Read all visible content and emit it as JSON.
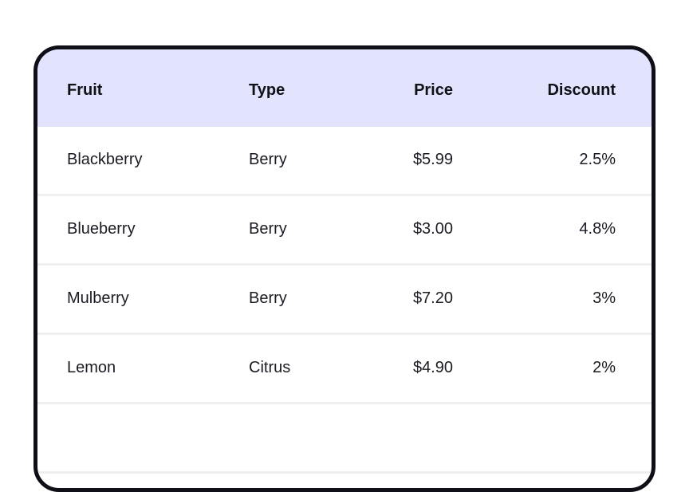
{
  "table": {
    "headers": {
      "fruit": "Fruit",
      "type": "Type",
      "price": "Price",
      "discount": "Discount"
    },
    "rows": [
      {
        "fruit": "Blackberry",
        "type": "Berry",
        "price": "$5.99",
        "discount": "2.5%"
      },
      {
        "fruit": "Blueberry",
        "type": "Berry",
        "price": "$3.00",
        "discount": "4.8%"
      },
      {
        "fruit": "Mulberry",
        "type": "Berry",
        "price": "$7.20",
        "discount": "3%"
      },
      {
        "fruit": "Lemon",
        "type": "Citrus",
        "price": "$4.90",
        "discount": "2%"
      },
      {
        "fruit": "",
        "type": "",
        "price": "",
        "discount": ""
      }
    ]
  },
  "colors": {
    "header_background": "#e2e3fd",
    "card_border": "#0f0f17",
    "row_divider": "#efefef"
  }
}
